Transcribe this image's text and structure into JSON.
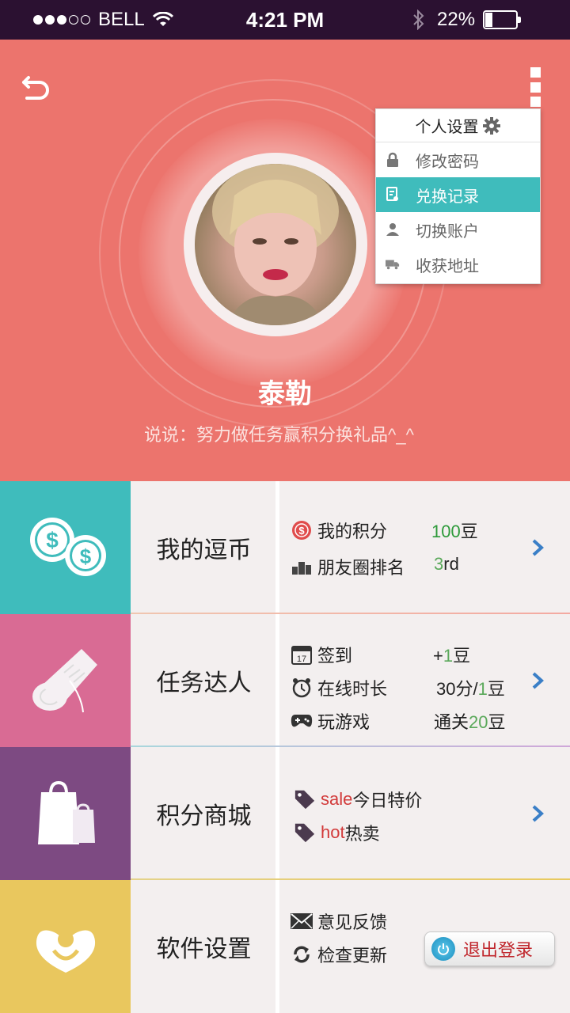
{
  "status_bar": {
    "carrier": "BELL",
    "time": "4:21 PM",
    "battery": "22%",
    "battery_level": 0.22,
    "signal_dots_filled": 3
  },
  "header": {
    "back_icon": "back-arrow-icon",
    "more_icon": "more-vertical-icon",
    "username": "泰勒",
    "motto": "说说：努力做任务赢积分换礼品^_^"
  },
  "dropdown": {
    "title": "个人设置",
    "title_icon": "gear-icon",
    "items": [
      {
        "label": "修改密码",
        "icon": "lock-icon",
        "active": false
      },
      {
        "label": "兑换记录",
        "icon": "record-icon",
        "active": true
      },
      {
        "label": "切换账户",
        "icon": "user-icon",
        "active": false
      },
      {
        "label": "收获地址",
        "icon": "truck-icon",
        "active": false
      }
    ]
  },
  "rows": {
    "coins": {
      "title": "我的逗币",
      "tile_color": "#3fbcbc",
      "points_label": "我的积分",
      "points_num": "100",
      "points_unit": "豆",
      "rank_label": "朋友圈排名",
      "rank_num": "3",
      "rank_unit": "rd"
    },
    "tasks": {
      "title": "任务达人",
      "tile_color": "#d96b94",
      "checkin_label": "签到",
      "checkin_pre": "+",
      "checkin_num": "1",
      "checkin_unit": "豆",
      "online_label": "在线时长",
      "online_pre": "30分/",
      "online_num": "1",
      "online_unit": "豆",
      "game_label": "玩游戏",
      "game_pre": "通关",
      "game_num": "20",
      "game_unit": "豆",
      "calendar_day": "17"
    },
    "mall": {
      "title": "积分商城",
      "tile_color": "#7d4a82",
      "sale_tag": "sale",
      "sale_label": "今日特价",
      "hot_tag": "hot",
      "hot_label": "热卖"
    },
    "settings": {
      "title": "软件设置",
      "tile_color": "#e9c75e",
      "feedback_label": "意见反馈",
      "update_label": "检查更新",
      "logout_label": "退出登录"
    }
  },
  "colors": {
    "header_bg": "#ec746d",
    "accent_teal": "#3fbcbc",
    "chevron_blue": "#3a7fc7"
  }
}
